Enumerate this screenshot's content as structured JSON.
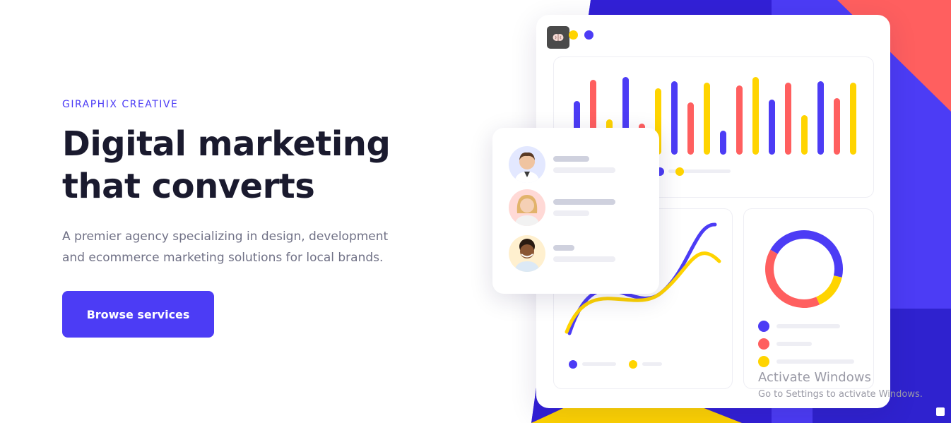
{
  "hero": {
    "eyebrow": "GIRAPHIX CREATIVE",
    "headline_line1": "Digital marketing",
    "headline_line2": "that converts",
    "description_line1": "A premier agency specializing in design, development",
    "description_line2": "and ecommerce marketing solutions for local brands.",
    "cta_label": "Browse services"
  },
  "colors": {
    "primary": "#4c3cf5",
    "coral": "#ff5f5f",
    "yellow": "#ffd400",
    "dark_indigo": "#2f22cf",
    "headline": "#1a1a2e",
    "body_text": "#707186"
  },
  "dashboard": {
    "brand_icon": "brain-icon",
    "bar_chart": {
      "type": "bar",
      "values": [
        0.38,
        0.53,
        0.25,
        0.55,
        0.22,
        0.47,
        0.52,
        0.37,
        0.51,
        0.17,
        0.49,
        0.55,
        0.39,
        0.51,
        0.28,
        0.52,
        0.4,
        0.51
      ],
      "colors": [
        "blue",
        "coral",
        "yellow",
        "blue",
        "coral",
        "yellow",
        "blue",
        "coral",
        "yellow",
        "blue",
        "coral",
        "yellow",
        "blue",
        "coral",
        "yellow",
        "blue",
        "coral",
        "yellow"
      ]
    },
    "donut_chart": {
      "type": "pie",
      "segments": [
        {
          "color": "blue",
          "value": 0.45
        },
        {
          "color": "yellow",
          "value": 0.15
        },
        {
          "color": "coral",
          "value": 0.4
        }
      ]
    },
    "people": [
      {
        "avatar": "man-avatar"
      },
      {
        "avatar": "woman-avatar"
      },
      {
        "avatar": "curly-man-avatar"
      }
    ]
  },
  "watermark": {
    "title": "Activate Windows",
    "subtitle": "Go to Settings to activate Windows."
  }
}
